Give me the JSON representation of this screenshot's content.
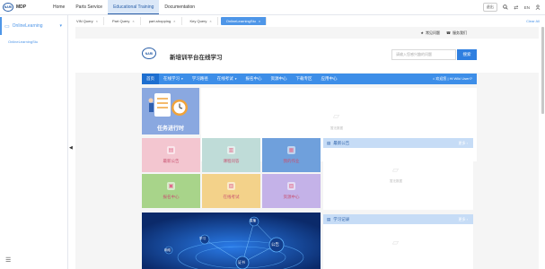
{
  "app": {
    "logo_mark": "NARI",
    "title": "MDP"
  },
  "topnav": [
    {
      "label": "Home",
      "active": false
    },
    {
      "label": "Parts Service",
      "active": false
    },
    {
      "label": "Educational Training",
      "active": true
    },
    {
      "label": "Documentation",
      "active": false
    }
  ],
  "topright": {
    "btn1": "退出",
    "lang": "EN",
    "lang_prefix": "⇄"
  },
  "tabs": [
    {
      "label": "VIN Query",
      "active": false
    },
    {
      "label": "Part Query",
      "active": false
    },
    {
      "label": "part-shopping",
      "active": false
    },
    {
      "label": "Key Query",
      "active": false
    },
    {
      "label": "OnlineLearningStu",
      "active": true
    }
  ],
  "clear_all": "Clear All",
  "sidebar": {
    "section": "OnlineLearning",
    "sub": "OnlineLearningStu"
  },
  "portal": {
    "util": {
      "faq": "常见问题",
      "service": "服务我们"
    },
    "logo_mark": "NARI",
    "title": "新培训平台在线学习",
    "search_placeholder": "请输入您感兴趣的问题",
    "search_btn": "搜索",
    "menu": [
      {
        "label": "首页",
        "active": true,
        "caret": false
      },
      {
        "label": "在线学习",
        "active": false,
        "caret": true
      },
      {
        "label": "学习路径",
        "active": false,
        "caret": false
      },
      {
        "label": "在线考试",
        "active": false,
        "caret": true
      },
      {
        "label": "报名中心",
        "active": false,
        "caret": false
      },
      {
        "label": "资源中心",
        "active": false,
        "caret": false
      },
      {
        "label": "下载专区",
        "active": false,
        "caret": false
      },
      {
        "label": "应用中心",
        "active": false,
        "caret": false
      }
    ],
    "user": "⌂ 欢迎您 | Hi Wiki User!?",
    "banner_caption": "任务进行时",
    "empty_text": "暂无数据",
    "total": "共 0 个待完成任务",
    "tiles": [
      {
        "label": "最新公告",
        "color": "#f3c6d0",
        "text_color": "#c84f6f"
      },
      {
        "label": "课程问答",
        "color": "#bfdcd8",
        "text_color": "#c84f6f"
      },
      {
        "label": "我的作业",
        "color": "#6fa0dc",
        "text_color": "#c84f6f"
      },
      {
        "label": "报名中心",
        "color": "#a8d48a",
        "text_color": "#c84f6f"
      },
      {
        "label": "在线考试",
        "color": "#f3d28a",
        "text_color": "#c84f6f"
      },
      {
        "label": "资源中心",
        "color": "#c4b2e8",
        "text_color": "#c84f6f"
      }
    ],
    "panels": [
      {
        "title": "最新公告",
        "more": "更多 ›"
      },
      {
        "title": "学习记录",
        "more": "更多 ›"
      }
    ],
    "tech_labels": [
      "学习",
      "直播",
      "证书",
      "公告",
      "网络"
    ]
  }
}
